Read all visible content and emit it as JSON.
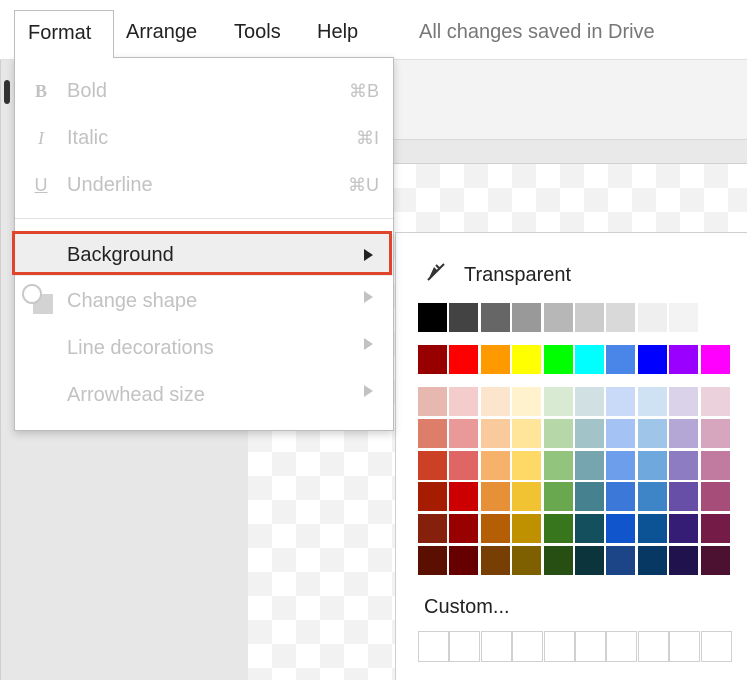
{
  "menubar": {
    "format": "Format",
    "arrange": "Arrange",
    "tools": "Tools",
    "help": "Help",
    "status": "All changes saved in Drive"
  },
  "format_menu": {
    "bold": {
      "label": "Bold",
      "icon": "B",
      "shortcut": "⌘B"
    },
    "italic": {
      "label": "Italic",
      "icon": "I",
      "shortcut": "⌘I"
    },
    "underline": {
      "label": "Underline",
      "icon": "U",
      "shortcut": "⌘U"
    },
    "background": {
      "label": "Background"
    },
    "change_shape": {
      "label": "Change shape"
    },
    "line_decorations": {
      "label": "Line decorations"
    },
    "arrowhead_size": {
      "label": "Arrowhead size"
    }
  },
  "palette": {
    "transparent_label": "Transparent",
    "transparent_icon": "no-fill-icon",
    "custom_label": "Custom...",
    "grayscale": [
      "#000000",
      "#434343",
      "#666666",
      "#999999",
      "#b7b7b7",
      "#cccccc",
      "#d9d9d9",
      "#efefef",
      "#f3f3f3",
      "#ffffff"
    ],
    "bright": [
      "#980000",
      "#ff0000",
      "#ff9900",
      "#ffff00",
      "#00ff00",
      "#00ffff",
      "#4a86e8",
      "#0000ff",
      "#9900ff",
      "#ff00ff"
    ],
    "shades": [
      [
        "#e6b8af",
        "#f4cccc",
        "#fce5cd",
        "#fff2cc",
        "#d9ead3",
        "#d0e0e3",
        "#c9daf8",
        "#cfe2f3",
        "#d9d2e9",
        "#ead1dc"
      ],
      [
        "#dd7e6b",
        "#ea9999",
        "#f9cb9c",
        "#ffe599",
        "#b6d7a8",
        "#a2c4c9",
        "#a4c2f4",
        "#9fc5e8",
        "#b4a7d6",
        "#d5a6bd"
      ],
      [
        "#cc4125",
        "#e06666",
        "#f6b26b",
        "#ffd966",
        "#93c47d",
        "#76a5af",
        "#6d9eeb",
        "#6fa8dc",
        "#8e7cc3",
        "#c27ba0"
      ],
      [
        "#a61c00",
        "#cc0000",
        "#e69138",
        "#f1c232",
        "#6aa84f",
        "#45818e",
        "#3c78d8",
        "#3d85c6",
        "#674ea7",
        "#a64d79"
      ],
      [
        "#85200c",
        "#990000",
        "#b45f06",
        "#bf9000",
        "#38761d",
        "#134f5c",
        "#1155cc",
        "#0b5394",
        "#351c75",
        "#741b47"
      ],
      [
        "#5b0f00",
        "#660000",
        "#783f04",
        "#7f6000",
        "#274e13",
        "#0c343d",
        "#1c4587",
        "#073763",
        "#20124d",
        "#4c1130"
      ]
    ],
    "custom_slots": 10,
    "highlight_color": "#e0452b"
  }
}
